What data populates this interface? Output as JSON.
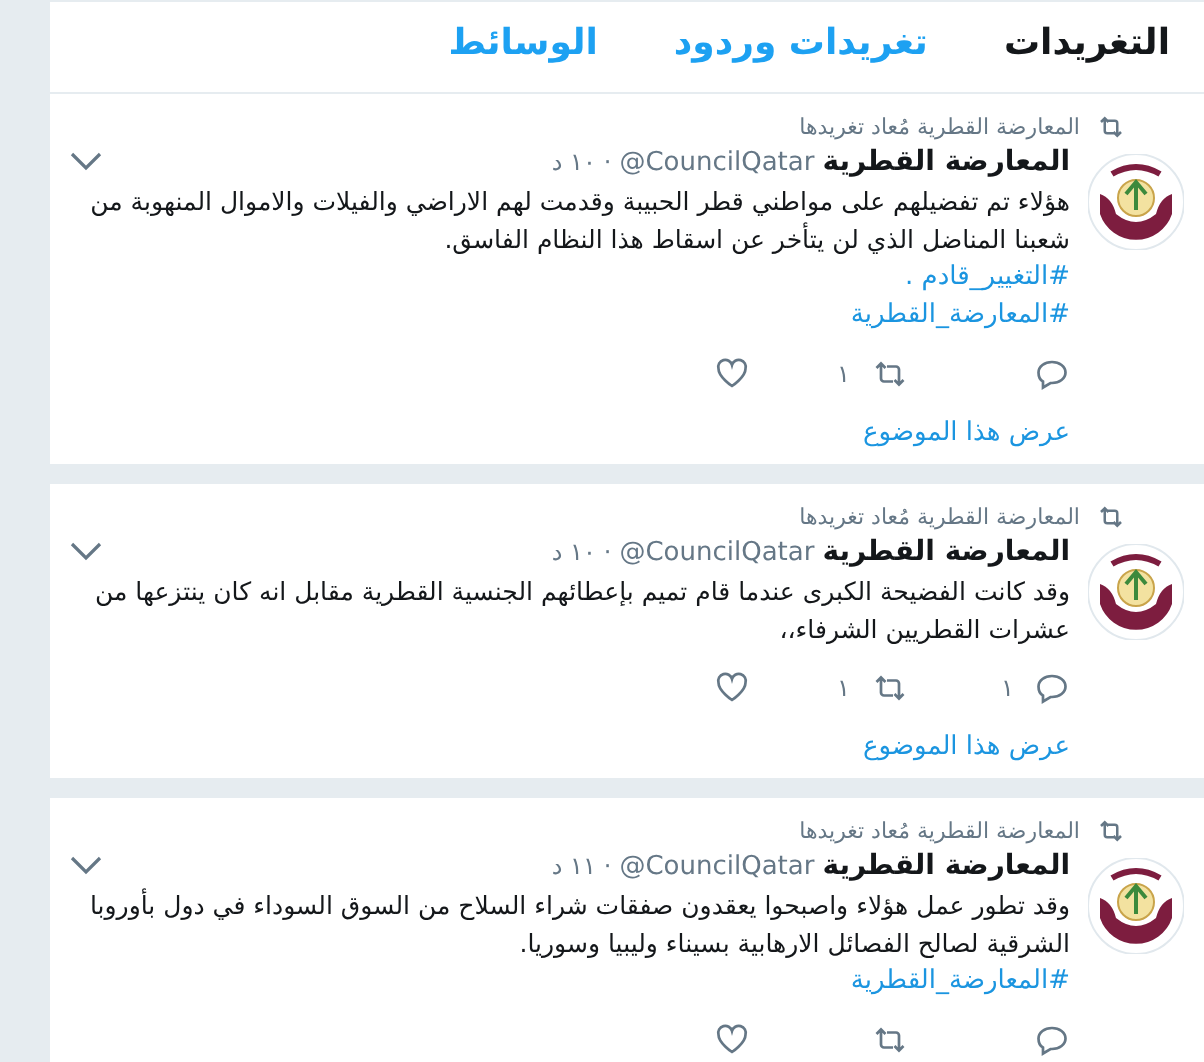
{
  "tabs": [
    {
      "label": "التغريدات",
      "selected": true
    },
    {
      "label": "تغريدات وردود",
      "selected": false
    },
    {
      "label": "الوسائط",
      "selected": false
    }
  ],
  "tweets": [
    {
      "context": "المعارضة القطرية مُعاد تغريدها",
      "name": "المعارضة القطرية",
      "handle": "@CouncilQatar",
      "separator": "·",
      "time": "١٠ د",
      "lines": [
        "هؤلاء تم تفضيلهم على مواطني قطر الحبيبة وقدمت لهم الاراضي والفيلات والاموال المنهوبة من شعبنا المناضل الذي لن يتأخر عن اسقاط هذا النظام الفاسق."
      ],
      "hashtags": [
        "#التغيير_قادم .",
        "#المعارضة_القطرية"
      ],
      "retweets": "١",
      "thread": "عرض هذا الموضوع"
    },
    {
      "context": "المعارضة القطرية مُعاد تغريدها",
      "name": "المعارضة القطرية",
      "handle": "@CouncilQatar",
      "separator": "·",
      "time": "١٠ د",
      "lines": [
        "وقد كانت الفضيحة الكبرى عندما قام تميم بإعطائهم الجنسية القطرية مقابل انه كان ينتزعها من عشرات القطريين الشرفاء،،"
      ],
      "replies": "١",
      "retweets": "١",
      "thread": "عرض هذا الموضوع"
    },
    {
      "context": "المعارضة القطرية مُعاد تغريدها",
      "name": "المعارضة القطرية",
      "handle": "@CouncilQatar",
      "separator": "·",
      "time": "١١ د",
      "lines": [
        "وقد تطور عمل هؤلاء واصبحوا يعقدون صفقات شراء السلاح من السوق السوداء في دول بأوروبا الشرقية لصالح الفصائل الارهابية بسيناء وليبيا وسوريا."
      ],
      "hashtags": [
        "#المعارضة_القطرية"
      ]
    }
  ]
}
